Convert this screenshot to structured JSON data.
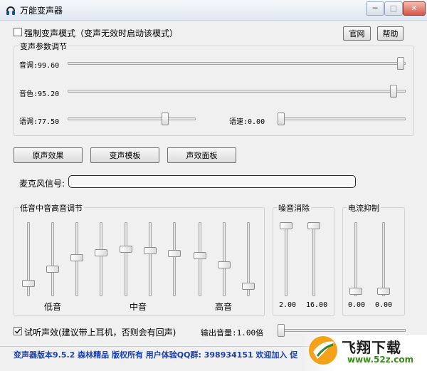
{
  "window": {
    "title": "万能变声器"
  },
  "controls": {
    "force_mode_label": "强制变声模式（变声无效时启动该模式）",
    "force_mode_checked": false,
    "official_site": "官网",
    "help": "帮助"
  },
  "params": {
    "legend": "变声参数调节",
    "pitch_label": "音调:99.60",
    "timbre_label": "音色:95.20",
    "tone_label": "语调:77.50",
    "speed_label": "语速:0.00"
  },
  "buttons": {
    "original": "原声效果",
    "template": "变声模板",
    "effects": "声效面板"
  },
  "mic": {
    "label": "麦克风信号:"
  },
  "eq": {
    "legend": "低音中音高音调节",
    "low": "低音",
    "mid": "中音",
    "high": "高音",
    "levels": [
      0.14,
      0.35,
      0.52,
      0.6,
      0.65,
      0.63,
      0.59,
      0.55,
      0.42,
      0.1
    ]
  },
  "noise": {
    "legend": "噪音消除",
    "values": [
      "2.00",
      "16.00"
    ]
  },
  "current": {
    "legend": "电流抑制",
    "values": [
      "0.00",
      "0.00"
    ]
  },
  "monitor": {
    "label": "试听声效(建议带上耳机，否则会有回声)",
    "checked": true,
    "volume_label": "输出音量:1.00倍"
  },
  "status": {
    "text": "变声器版本9.5.2 森林精品 版权所有 用户体验QQ群: 398934151 欢迎加入 促"
  },
  "watermark": {
    "brand": "飞翔下载",
    "url": "www.52z.com"
  }
}
